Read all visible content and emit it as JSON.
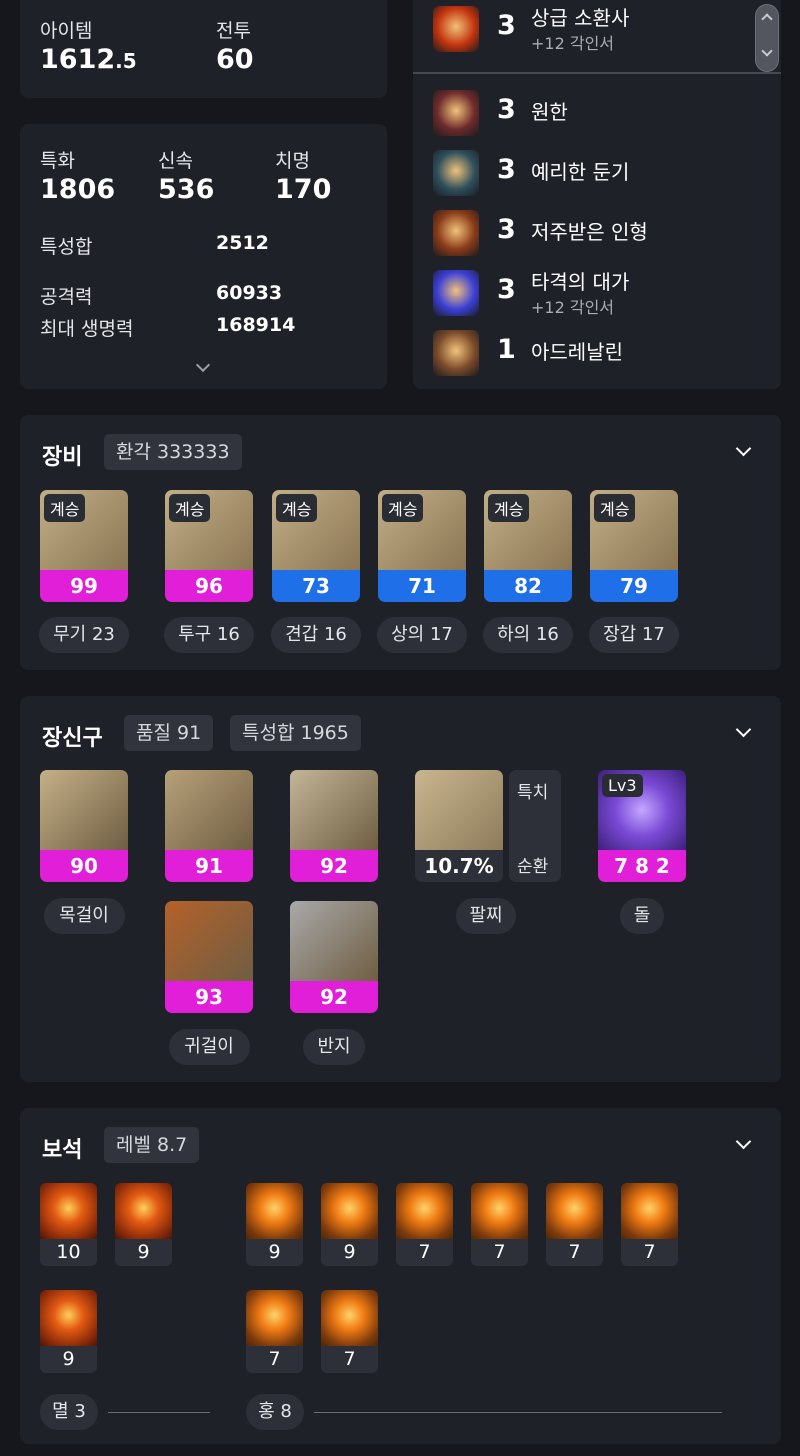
{
  "stats_top": {
    "item_label": "아이템",
    "item_value_int": "1612",
    "item_value_dec": ".5",
    "combat_label": "전투",
    "combat_value": "60"
  },
  "stats": {
    "crit_label": "특화",
    "crit_value": "1806",
    "swift_label": "신속",
    "swift_value": "536",
    "fatal_label": "치명",
    "fatal_value": "170",
    "sum_label": "특성합",
    "sum_value": "2512",
    "atk_label": "공격력",
    "atk_value": "60933",
    "hp_label": "최대 생명력",
    "hp_value": "168914"
  },
  "engravings": [
    {
      "level": "3",
      "name": "상급 소환사",
      "sub": "+12 각인서",
      "color": "#c2330e"
    },
    {
      "level": "3",
      "name": "원한",
      "sub": "",
      "color": "#6d2a2a"
    },
    {
      "level": "3",
      "name": "예리한 둔기",
      "sub": "",
      "color": "#2e4f5c"
    },
    {
      "level": "3",
      "name": "저주받은 인형",
      "sub": "",
      "color": "#8a3a18"
    },
    {
      "level": "3",
      "name": "타격의 대가",
      "sub": "+12 각인서",
      "color": "#3b3fd6"
    },
    {
      "level": "1",
      "name": "아드레날린",
      "sub": "",
      "color": "#7a4a2a"
    }
  ],
  "equipment": {
    "title": "장비",
    "tag": "환각 333333",
    "items": [
      {
        "badge": "계승",
        "quality": "99",
        "color": "pink",
        "label": "무기 23"
      },
      {
        "badge": "계승",
        "quality": "96",
        "color": "pink",
        "label": "투구 16"
      },
      {
        "badge": "계승",
        "quality": "73",
        "color": "blue",
        "label": "견갑 16"
      },
      {
        "badge": "계승",
        "quality": "71",
        "color": "blue",
        "label": "상의 17"
      },
      {
        "badge": "계승",
        "quality": "82",
        "color": "blue",
        "label": "하의 16"
      },
      {
        "badge": "계승",
        "quality": "79",
        "color": "blue",
        "label": "장갑 17"
      }
    ]
  },
  "accessories": {
    "title": "장신구",
    "tag1": "품질 91",
    "tag2": "특성합 1965",
    "items": [
      {
        "quality": "90",
        "label": "목걸이"
      },
      {
        "quality": "91",
        "label": ""
      },
      {
        "quality": "92",
        "label": ""
      },
      {
        "quality": "93",
        "label": "귀걸이"
      },
      {
        "quality": "92",
        "label": "반지"
      }
    ],
    "bracelet": {
      "value": "10.7%",
      "label": "팔찌",
      "stat1": "특치",
      "stat2": "순환"
    },
    "stone": {
      "level": "Lv3",
      "value": "7 8 2",
      "label": "돌"
    }
  },
  "gems": {
    "title": "보석",
    "tag": "레벨 8.7",
    "left": [
      {
        "level": "10"
      },
      {
        "level": "9"
      },
      {
        "level": "9"
      }
    ],
    "right": [
      {
        "level": "9"
      },
      {
        "level": "9"
      },
      {
        "level": "7"
      },
      {
        "level": "7"
      },
      {
        "level": "7"
      },
      {
        "level": "7"
      },
      {
        "level": "7"
      },
      {
        "level": "7"
      }
    ],
    "left_label": "멸 3",
    "right_label": "홍 8"
  }
}
